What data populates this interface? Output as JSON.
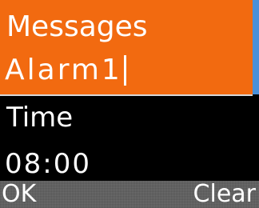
{
  "colors": {
    "focus_background": "#f26a10",
    "screen_background": "#000000",
    "scrollbar_thumb": "#4a90d9",
    "softkey_background": "#6e6e6e",
    "text": "#ffffff"
  },
  "messages_field": {
    "label": "Messages",
    "value": "Alarm1"
  },
  "time_field": {
    "label": "Time",
    "value": "08:00"
  },
  "softkeys": {
    "left": "OK",
    "right": "Clear"
  }
}
